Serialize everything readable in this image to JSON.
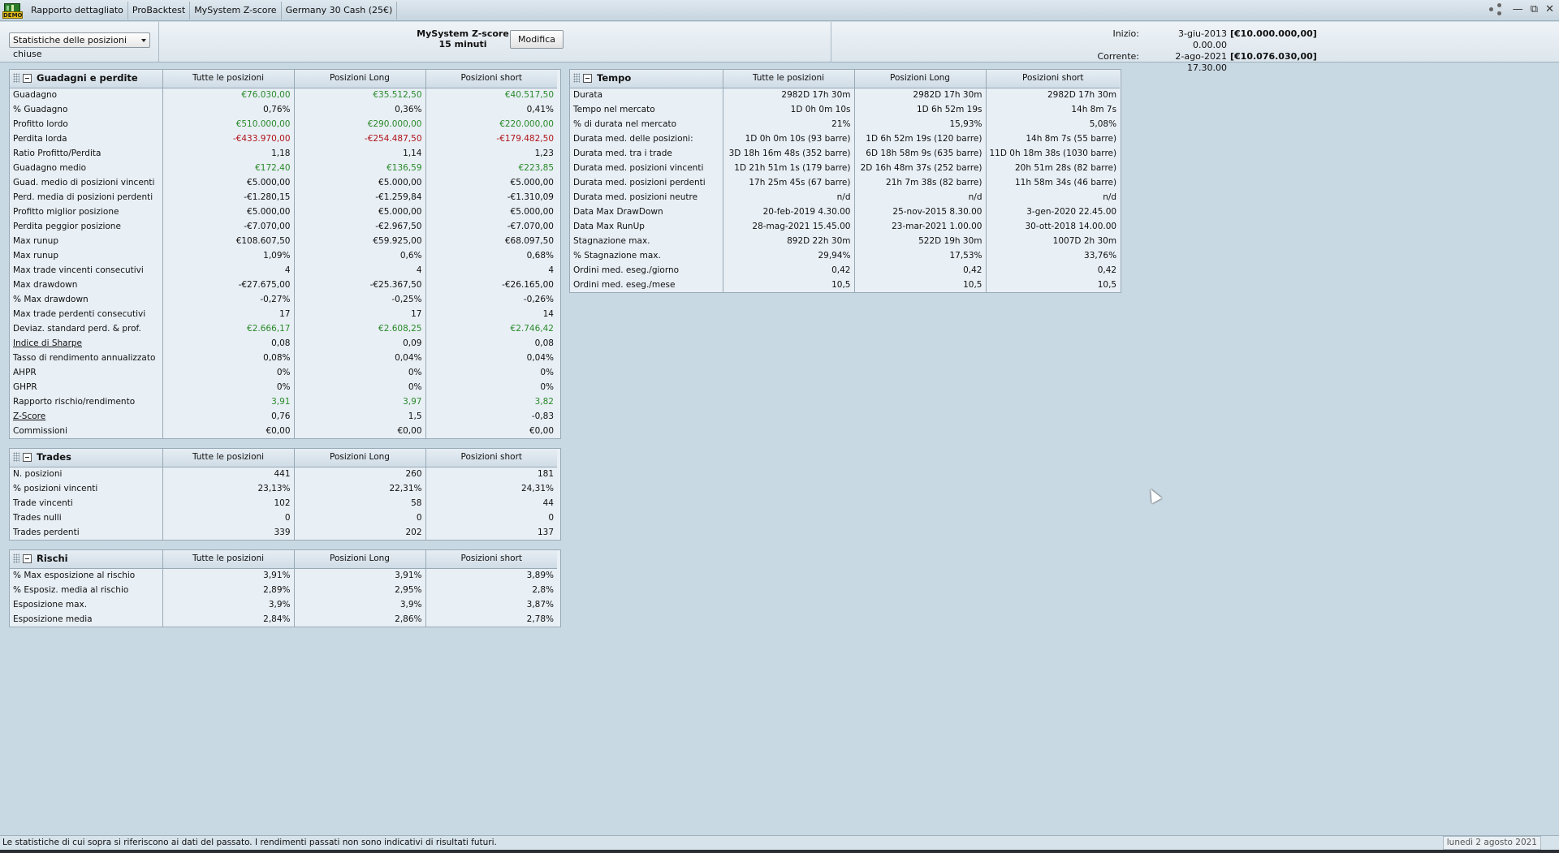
{
  "titlebar": {
    "tabs": [
      "Rapporto dettagliato",
      "ProBacktest",
      "MySystem Z-score",
      "Germany 30 Cash (25€)"
    ],
    "logo_text": "DEMO"
  },
  "header": {
    "dropdown": "Statistiche delle posizioni chiuse",
    "system_name": "MySystem Z-score",
    "timeframe": "15 minuti",
    "edit_button": "Modifica",
    "start_label": "Inizio:",
    "start_date": "3-giu-2013 0.00.00",
    "start_amount": "[€10.000.000,00]",
    "current_label": "Corrente:",
    "current_date": "2-ago-2021 17.30.00",
    "current_amount": "[€10.076.030,00]"
  },
  "columns": [
    "Tutte le posizioni",
    "Posizioni Long",
    "Posizioni short"
  ],
  "gains": {
    "title": "Guadagni e perdite",
    "rows": [
      {
        "label": "Guadagno",
        "v": [
          "€76.030,00",
          "€35.512,50",
          "€40.517,50"
        ],
        "c": "pos"
      },
      {
        "label": "% Guadagno",
        "v": [
          "0,76%",
          "0,36%",
          "0,41%"
        ]
      },
      {
        "label": "Profitto lordo",
        "v": [
          "€510.000,00",
          "€290.000,00",
          "€220.000,00"
        ],
        "c": "pos"
      },
      {
        "label": "Perdita lorda",
        "v": [
          "-€433.970,00",
          "-€254.487,50",
          "-€179.482,50"
        ],
        "c": "neg"
      },
      {
        "label": "Ratio Profitto/Perdita",
        "v": [
          "1,18",
          "1,14",
          "1,23"
        ]
      },
      {
        "label": "Guadagno medio",
        "v": [
          "€172,40",
          "€136,59",
          "€223,85"
        ],
        "c": "pos"
      },
      {
        "label": "Guad. medio di posizioni vincenti",
        "v": [
          "€5.000,00",
          "€5.000,00",
          "€5.000,00"
        ]
      },
      {
        "label": "Perd. media di posizioni perdenti",
        "v": [
          "-€1.280,15",
          "-€1.259,84",
          "-€1.310,09"
        ]
      },
      {
        "label": "Profitto miglior posizione",
        "v": [
          "€5.000,00",
          "€5.000,00",
          "€5.000,00"
        ]
      },
      {
        "label": "Perdita peggior posizione",
        "v": [
          "-€7.070,00",
          "-€2.967,50",
          "-€7.070,00"
        ]
      },
      {
        "label": "Max runup",
        "v": [
          "€108.607,50",
          "€59.925,00",
          "€68.097,50"
        ]
      },
      {
        "label": "Max runup",
        "v": [
          "1,09%",
          "0,6%",
          "0,68%"
        ]
      },
      {
        "label": "Max trade vincenti consecutivi",
        "v": [
          "4",
          "4",
          "4"
        ]
      },
      {
        "label": "Max drawdown",
        "v": [
          "-€27.675,00",
          "-€25.367,50",
          "-€26.165,00"
        ]
      },
      {
        "label": "% Max drawdown",
        "v": [
          "-0,27%",
          "-0,25%",
          "-0,26%"
        ]
      },
      {
        "label": "Max trade perdenti consecutivi",
        "v": [
          "17",
          "17",
          "14"
        ]
      },
      {
        "label": "Deviaz. standard perd. & prof.",
        "v": [
          "€2.666,17",
          "€2.608,25",
          "€2.746,42"
        ],
        "c": "pos"
      },
      {
        "label": "Indice di Sharpe",
        "v": [
          "0,08",
          "0,09",
          "0,08"
        ],
        "u": true
      },
      {
        "label": "Tasso di rendimento annualizzato",
        "v": [
          "0,08%",
          "0,04%",
          "0,04%"
        ]
      },
      {
        "label": "AHPR",
        "v": [
          "0%",
          "0%",
          "0%"
        ]
      },
      {
        "label": "GHPR",
        "v": [
          "0%",
          "0%",
          "0%"
        ]
      },
      {
        "label": "Rapporto rischio/rendimento",
        "v": [
          "3,91",
          "3,97",
          "3,82"
        ],
        "c": "pos"
      },
      {
        "label": "Z-Score",
        "v": [
          "0,76",
          "1,5",
          "-0,83"
        ],
        "u": true
      },
      {
        "label": "Commissioni",
        "v": [
          "€0,00",
          "€0,00",
          "€0,00"
        ]
      }
    ]
  },
  "trades": {
    "title": "Trades",
    "rows": [
      {
        "label": "N. posizioni",
        "v": [
          "441",
          "260",
          "181"
        ]
      },
      {
        "label": "% posizioni vincenti",
        "v": [
          "23,13%",
          "22,31%",
          "24,31%"
        ]
      },
      {
        "label": "Trade vincenti",
        "v": [
          "102",
          "58",
          "44"
        ]
      },
      {
        "label": "Trades nulli",
        "v": [
          "0",
          "0",
          "0"
        ]
      },
      {
        "label": "Trades perdenti",
        "v": [
          "339",
          "202",
          "137"
        ]
      }
    ]
  },
  "risks": {
    "title": "Rischi",
    "rows": [
      {
        "label": "% Max esposizione al rischio",
        "v": [
          "3,91%",
          "3,91%",
          "3,89%"
        ]
      },
      {
        "label": "% Esposiz. media al rischio",
        "v": [
          "2,89%",
          "2,95%",
          "2,8%"
        ]
      },
      {
        "label": "Esposizione max.",
        "v": [
          "3,9%",
          "3,9%",
          "3,87%"
        ]
      },
      {
        "label": "Esposizione media",
        "v": [
          "2,84%",
          "2,86%",
          "2,78%"
        ]
      }
    ]
  },
  "time": {
    "title": "Tempo",
    "rows": [
      {
        "label": "Durata",
        "v": [
          "2982D 17h 30m",
          "2982D 17h 30m",
          "2982D 17h 30m"
        ]
      },
      {
        "label": "Tempo nel mercato",
        "v": [
          "1D 0h 0m 10s",
          "1D 6h 52m 19s",
          "14h 8m 7s"
        ]
      },
      {
        "label": "% di durata nel mercato",
        "v": [
          "21%",
          "15,93%",
          "5,08%"
        ]
      },
      {
        "label": "Durata med. delle posizioni:",
        "v": [
          "1D 0h 0m 10s (93 barre)",
          "1D 6h 52m 19s (120 barre)",
          "14h 8m 7s (55 barre)"
        ]
      },
      {
        "label": "Durata med. tra i trade",
        "v": [
          "3D 18h 16m 48s (352 barre)",
          "6D 18h 58m 9s (635 barre)",
          "11D 0h 18m 38s (1030 barre)"
        ]
      },
      {
        "label": "Durata med. posizioni vincenti",
        "v": [
          "1D 21h 51m 1s (179 barre)",
          "2D 16h 48m 37s (252 barre)",
          "20h 51m 28s (82 barre)"
        ]
      },
      {
        "label": "Durata med. posizioni perdenti",
        "v": [
          "17h 25m 45s (67 barre)",
          "21h 7m 38s (82 barre)",
          "11h 58m 34s (46 barre)"
        ]
      },
      {
        "label": "Durata med. posizioni neutre",
        "v": [
          "n/d",
          "n/d",
          "n/d"
        ]
      },
      {
        "label": "Data Max DrawDown",
        "v": [
          "20-feb-2019 4.30.00",
          "25-nov-2015 8.30.00",
          "3-gen-2020 22.45.00"
        ]
      },
      {
        "label": "Data Max RunUp",
        "v": [
          "28-mag-2021 15.45.00",
          "23-mar-2021 1.00.00",
          "30-ott-2018 14.00.00"
        ]
      },
      {
        "label": "Stagnazione max.",
        "v": [
          "892D 22h 30m",
          "522D 19h 30m",
          "1007D 2h 30m"
        ]
      },
      {
        "label": "% Stagnazione max.",
        "v": [
          "29,94%",
          "17,53%",
          "33,76%"
        ]
      },
      {
        "label": "Ordini med. eseg./giorno",
        "v": [
          "0,42",
          "0,42",
          "0,42"
        ]
      },
      {
        "label": "Ordini med. eseg./mese",
        "v": [
          "10,5",
          "10,5",
          "10,5"
        ]
      }
    ]
  },
  "footer": {
    "disclaimer": "Le statistiche di cui sopra si riferiscono ai dati del passato. I rendimenti passati non sono indicativi di risultati futuri.",
    "date": "lunedì 2 agosto 2021"
  },
  "colors": {
    "positive": "#2a8a2a",
    "negative": "#b0141a",
    "background": "#c9d9e3"
  }
}
